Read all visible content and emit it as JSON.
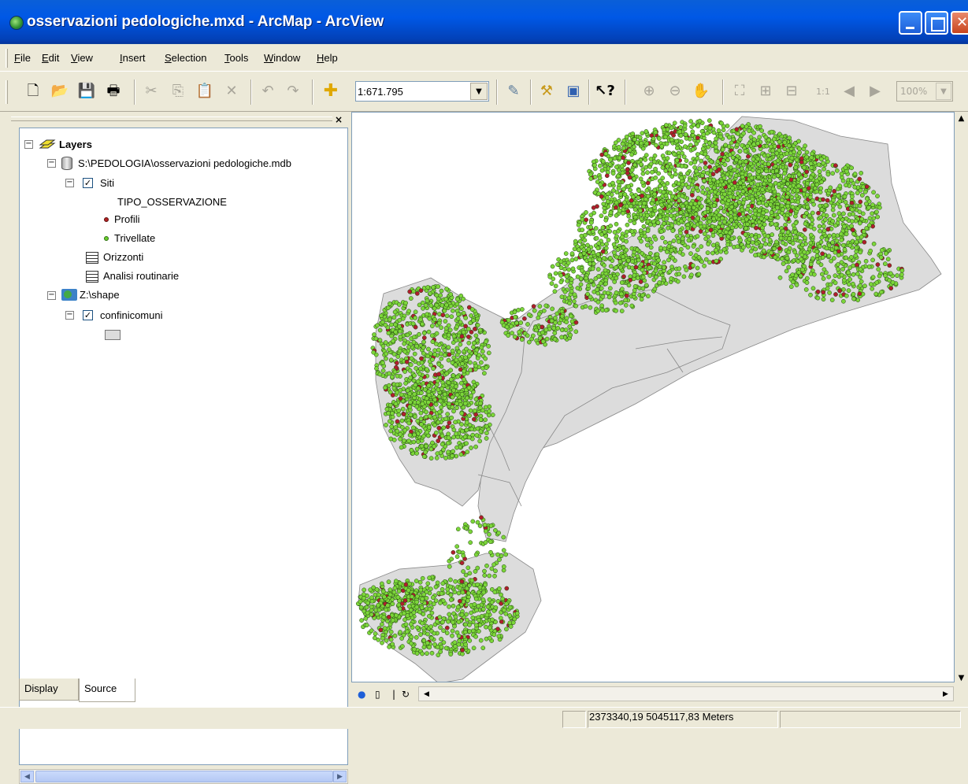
{
  "window": {
    "title": "osservazioni pedologiche.mxd - ArcMap - ArcView"
  },
  "menu": [
    "File",
    "Edit",
    "View",
    "Insert",
    "Selection",
    "Tools",
    "Window",
    "Help"
  ],
  "toolbar": {
    "scale": "1:671.795",
    "zoom": "100%",
    "icons": [
      "new-document-icon",
      "open-folder-icon",
      "save-icon",
      "print-icon",
      "cut-icon",
      "copy-icon",
      "paste-icon",
      "delete-icon",
      "undo-icon",
      "redo-icon",
      "add-data-icon",
      "editor-toolbar-icon",
      "arctoolbox-icon",
      "command-line-icon",
      "whats-this-icon",
      "zoom-in-fixed-icon",
      "zoom-out-fixed-icon",
      "pan-icon",
      "full-extent-icon",
      "fixed-zoom-in-icon",
      "fixed-zoom-out-icon",
      "zoom-to-100-icon",
      "back-extent-icon",
      "forward-extent-icon"
    ]
  },
  "toc": {
    "root": "Layers",
    "database": "S:\\PEDOLOGIA\\osservazioni pedologiche.mdb",
    "siti": "Siti",
    "field": "TIPO_OSSERVAZIONE",
    "legend": [
      {
        "label": "Profili",
        "color": "#B22222"
      },
      {
        "label": "Trivellate",
        "color": "#6ACD2E"
      }
    ],
    "tables": [
      "Orizzonti",
      "Analisi routinarie"
    ],
    "shape_folder": "Z:\\shape",
    "confini": "confinicomuni",
    "confini_fill": "#DCDCDC",
    "tabs": [
      "Display",
      "Source"
    ]
  },
  "map": {
    "land_fill": "#DCDCDC",
    "point_green": "#7CD63A",
    "point_red": "#B01E2E"
  },
  "status": {
    "coordinates": "2373340,19  5045117,83 Meters"
  }
}
